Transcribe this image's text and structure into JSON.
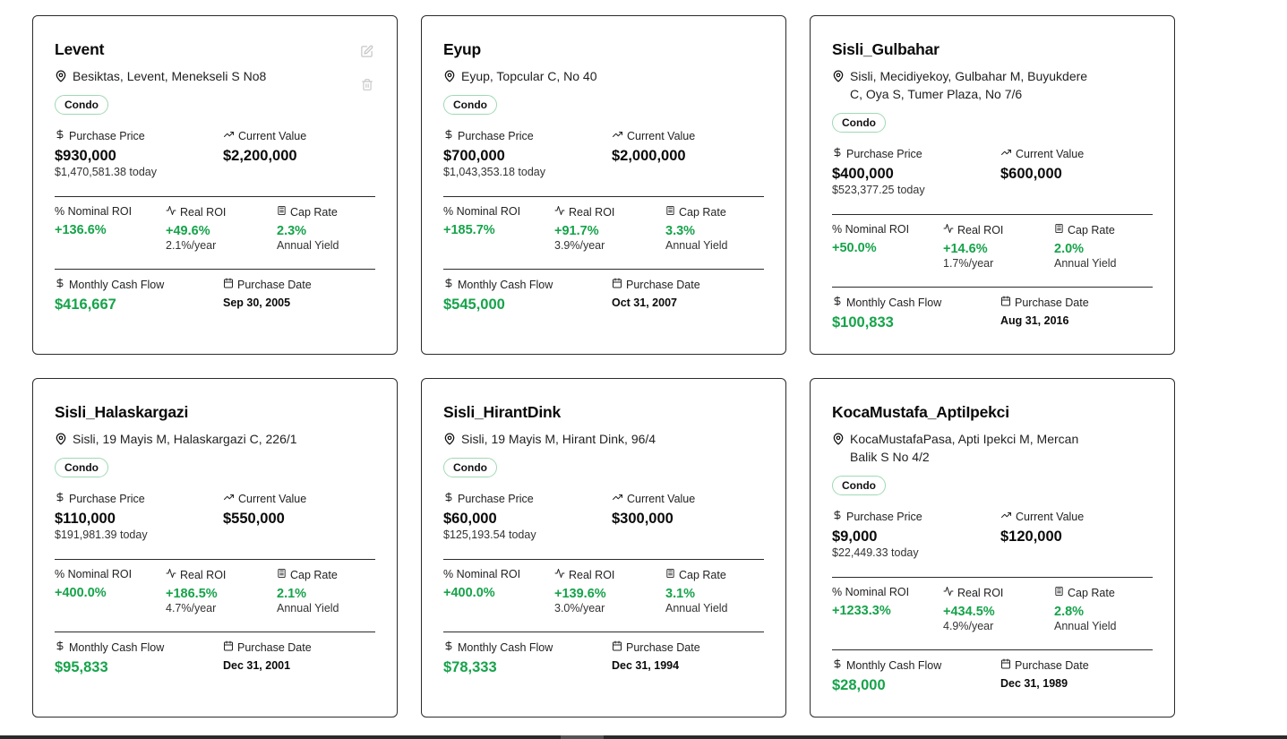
{
  "labels": {
    "purchase_price": "Purchase Price",
    "current_value": "Current Value",
    "nominal_roi": "% Nominal ROI",
    "real_roi": "Real ROI",
    "cap_rate": "Cap Rate",
    "annual_yield": "Annual Yield",
    "monthly_cash_flow": "Monthly Cash Flow",
    "purchase_date": "Purchase Date"
  },
  "colors": {
    "accent_green": "#16a34a",
    "badge_border": "#9fd9b4"
  },
  "icons": {
    "location": "map-pin-icon",
    "dollar": "dollar-icon",
    "trend": "trending-up-icon",
    "activity": "activity-icon",
    "calculator": "calculator-icon",
    "calendar": "calendar-icon",
    "edit": "edit-icon",
    "delete": "trash-icon"
  },
  "properties": [
    {
      "name": "Levent",
      "address": "Besiktas, Levent, Menekseli S No8",
      "type": "Condo",
      "purchase_price": "$930,000",
      "purchase_today": "$1,470,581.38 today",
      "current_value": "$2,200,000",
      "nominal_roi": "+136.6%",
      "real_roi": "+49.6%",
      "real_roi_year": "2.1%/year",
      "cap_rate": "2.3%",
      "monthly_cash_flow": "$416,667",
      "purchase_date": "Sep 30, 2005"
    },
    {
      "name": "Eyup",
      "address": "Eyup, Topcular C, No 40",
      "type": "Condo",
      "purchase_price": "$700,000",
      "purchase_today": "$1,043,353.18 today",
      "current_value": "$2,000,000",
      "nominal_roi": "+185.7%",
      "real_roi": "+91.7%",
      "real_roi_year": "3.9%/year",
      "cap_rate": "3.3%",
      "monthly_cash_flow": "$545,000",
      "purchase_date": "Oct 31, 2007"
    },
    {
      "name": "Sisli_Gulbahar",
      "address": "Sisli, Mecidiyekoy, Gulbahar M, Buyukdere C, Oya S, Tumer Plaza, No 7/6",
      "type": "Condo",
      "purchase_price": "$400,000",
      "purchase_today": "$523,377.25 today",
      "current_value": "$600,000",
      "nominal_roi": "+50.0%",
      "real_roi": "+14.6%",
      "real_roi_year": "1.7%/year",
      "cap_rate": "2.0%",
      "monthly_cash_flow": "$100,833",
      "purchase_date": "Aug 31, 2016"
    },
    {
      "name": "Sisli_Halaskargazi",
      "address": "Sisli, 19 Mayis M, Halaskargazi C, 226/1",
      "type": "Condo",
      "purchase_price": "$110,000",
      "purchase_today": "$191,981.39 today",
      "current_value": "$550,000",
      "nominal_roi": "+400.0%",
      "real_roi": "+186.5%",
      "real_roi_year": "4.7%/year",
      "cap_rate": "2.1%",
      "monthly_cash_flow": "$95,833",
      "purchase_date": "Dec 31, 2001"
    },
    {
      "name": "Sisli_HirantDink",
      "address": "Sisli, 19 Mayis M, Hirant Dink, 96/4",
      "type": "Condo",
      "purchase_price": "$60,000",
      "purchase_today": "$125,193.54 today",
      "current_value": "$300,000",
      "nominal_roi": "+400.0%",
      "real_roi": "+139.6%",
      "real_roi_year": "3.0%/year",
      "cap_rate": "3.1%",
      "monthly_cash_flow": "$78,333",
      "purchase_date": "Dec 31, 1994"
    },
    {
      "name": "KocaMustafa_AptiIpekci",
      "address": "KocaMustafaPasa, Apti Ipekci M, Mercan Balik S No 4/2",
      "type": "Condo",
      "purchase_price": "$9,000",
      "purchase_today": "$22,449.33 today",
      "current_value": "$120,000",
      "nominal_roi": "+1233.3%",
      "real_roi": "+434.5%",
      "real_roi_year": "4.9%/year",
      "cap_rate": "2.8%",
      "monthly_cash_flow": "$28,000",
      "purchase_date": "Dec 31, 1989"
    }
  ]
}
